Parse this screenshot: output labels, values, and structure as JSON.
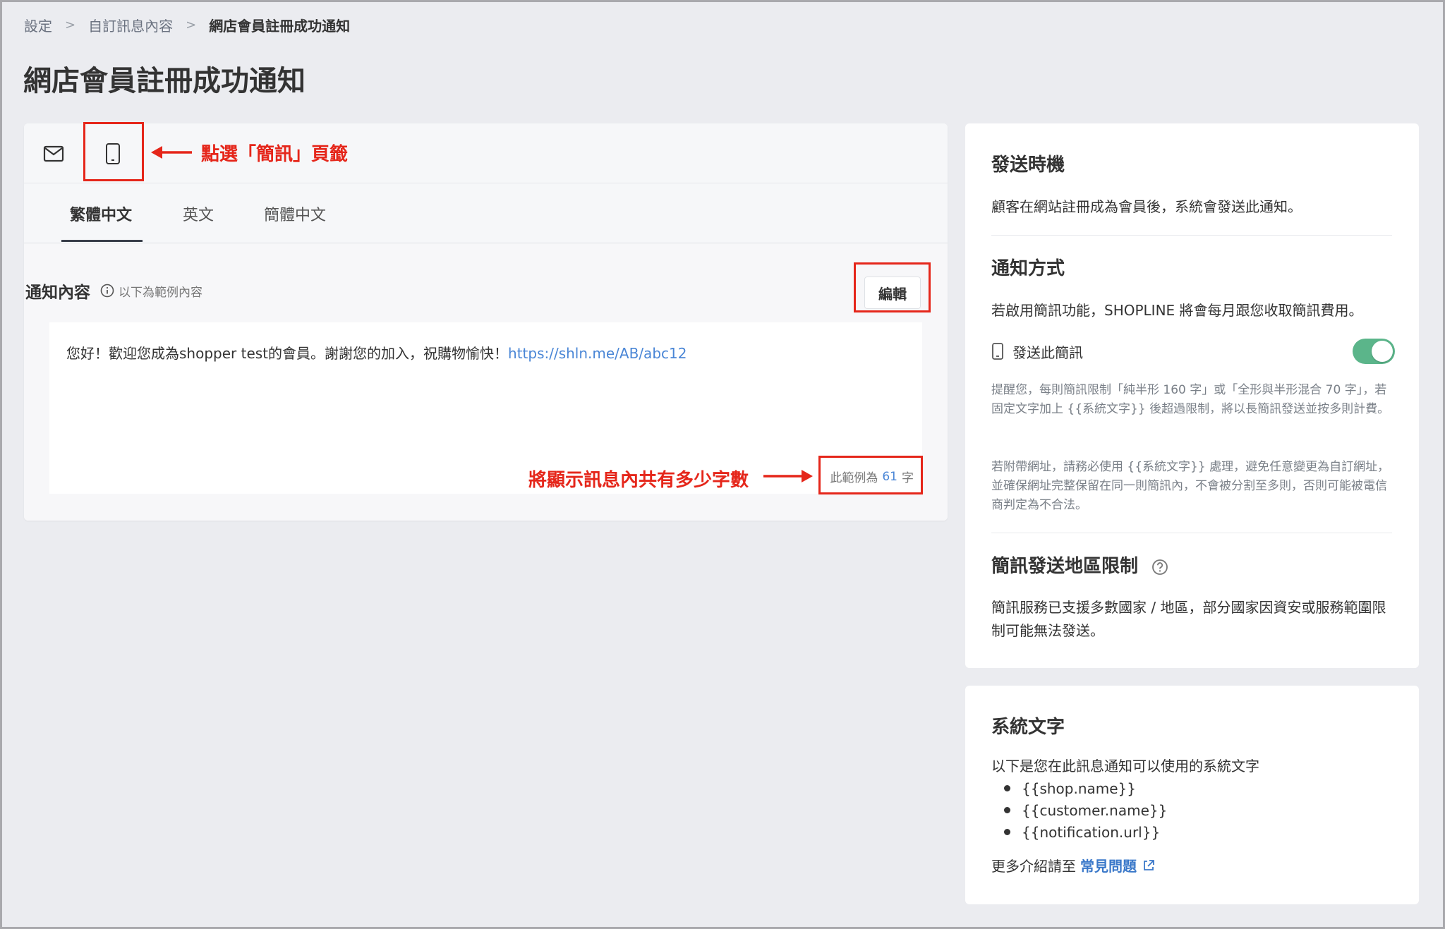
{
  "breadcrumb": {
    "items": [
      "設定",
      "自訂訊息內容"
    ],
    "current": "網店會員註冊成功通知"
  },
  "page_title": "網店會員註冊成功通知",
  "channels": [
    {
      "name": "email",
      "icon": "mail-icon"
    },
    {
      "name": "sms",
      "icon": "mobile-icon"
    }
  ],
  "lang_tabs": [
    "繁體中文",
    "英文",
    "簡體中文"
  ],
  "content": {
    "title": "通知內容",
    "hint": "以下為範例內容",
    "edit_label": "編輯",
    "message_text": "您好！歡迎您成為shopper test的會員。謝謝您的加入，祝購物愉快！",
    "message_link": "https://shln.me/AB/abc12",
    "count_prefix": "此範例為",
    "count_value": "61",
    "count_suffix": "字"
  },
  "timing": {
    "title": "發送時機",
    "text": "顧客在網站註冊成為會員後，系統會發送此通知。"
  },
  "method": {
    "title": "通知方式",
    "text": "若啟用簡訊功能，SHOPLINE 將會每月跟您收取簡訊費用。",
    "sms_label": "發送此簡訊",
    "sms_enabled": true,
    "note1": "提醒您，每則簡訊限制「純半形 160 字」或「全形與半形混合 70 字」，若固定文字加上 {{系統文字}} 後超過限制，將以長簡訊發送並按多則計費。",
    "note2": "若附帶網址，請務必使用 {{系統文字}} 處理，避免任意變更為自訂網址，並確保網址完整保留在同一則簡訊內，不會被分割至多則，否則可能被電信商判定為不合法。"
  },
  "region": {
    "title": "簡訊發送地區限制",
    "text": "簡訊服務已支援多數國家 / 地區，部分國家因資安或服務範圍限制可能無法發送。"
  },
  "system_text": {
    "title": "系統文字",
    "intro": "以下是您在此訊息通知可以使用的系統文字",
    "variables": [
      "{{shop.name}}",
      "{{customer.name}}",
      "{{notification.url}}"
    ],
    "faq_prefix": "更多介紹請至",
    "faq_link": "常見問題"
  },
  "annotations": {
    "sms_tab_note": "點選「簡訊」頁籤",
    "count_note": "將顯示訊息內共有多少字數"
  },
  "colors": {
    "annotation_red": "#e5261a",
    "toggle_on": "#5bb58a",
    "link_blue": "#4a86d6"
  }
}
